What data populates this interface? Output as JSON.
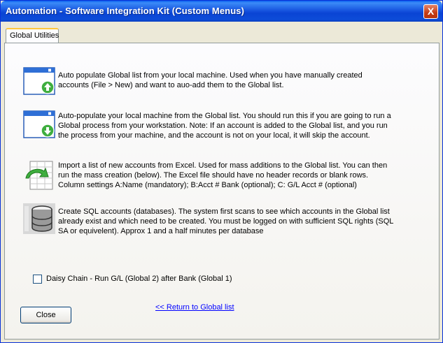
{
  "window": {
    "title": "Automation - Software Integration Kit (Custom Menus)",
    "close_glyph": "X"
  },
  "tabs": [
    {
      "label": "Global Utilities",
      "selected": true
    }
  ],
  "actions": [
    {
      "icon": "window-upload-icon",
      "text": "Auto populate Global list from your local machine.  Used when you have manually created accounts (File > New) and want to auo-add them to the Global list."
    },
    {
      "icon": "window-download-icon",
      "text": "Auto-populate your local machine from the Global list.  You should run this if you are going to run a Global process from your workstation. Note: If an account is added to the Global list, and you run the process from your machine, and the account is not on your local, it will skip the account."
    },
    {
      "icon": "excel-import-icon",
      "text": "Import a list of new accounts from Excel.  Used for mass additions to the Global list.  You can then run the mass creation (below).  The Excel file should have no header records or blank rows.  Column settings A:Name (mandatory); B:Acct # Bank (optional); C: G/L Acct # (optional)"
    },
    {
      "icon": "sql-database-icon",
      "text": "Create SQL accounts (databases). The system first scans to see which accounts in the Global list already exist and which need to be created.  You must be logged on with sufficient SQL rights (SQL SA or equivelent).  Approx 1 and a half minutes per database"
    }
  ],
  "daisy_chain": {
    "label": "Daisy Chain - Run G/L (Global 2) after Bank (Global 1)",
    "checked": false
  },
  "return_link": "<< Return to Global list",
  "close_button": "Close",
  "colors": {
    "titlebar": "#0a44d4",
    "face": "#ece9d8",
    "link": "#0000ff",
    "tab_highlight": "#ffc73c"
  }
}
